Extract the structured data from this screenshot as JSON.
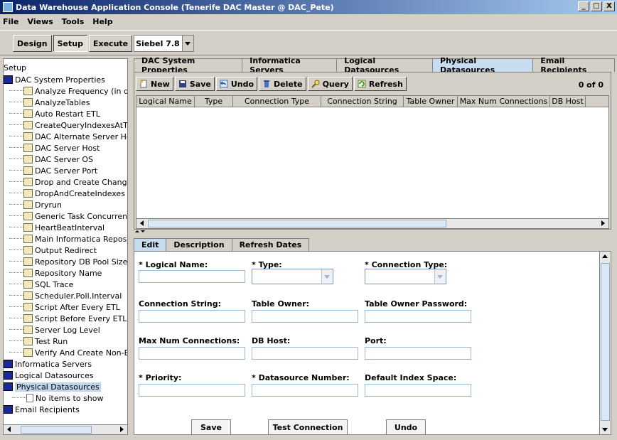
{
  "window": {
    "title": "Data Warehouse Application Console (Tenerife DAC Master @ DAC_Pete)",
    "controls": [
      "_",
      "□",
      "X"
    ]
  },
  "menu": [
    "File",
    "Views",
    "Tools",
    "Help"
  ],
  "toolbar": {
    "design": "Design",
    "setup": "Setup",
    "execute": "Execute",
    "version": "Siebel 7.8"
  },
  "tree": {
    "root": "Setup",
    "system_properties": "DAC System Properties",
    "properties": [
      "Analyze Frequency (in days)",
      "AnalyzeTables",
      "Auto Restart ETL",
      "CreateQueryIndexesAtTheEnd",
      "DAC Alternate Server Hosts",
      "DAC Server Host",
      "DAC Server OS",
      "DAC Server Port",
      "Drop and Create Change Capture Views",
      "DropAndCreateIndexes",
      "Dryrun",
      "Generic Task Concurrency",
      "HeartBeatInterval",
      "Main Informatica Repository",
      "Output Redirect",
      "Repository DB Pool Size",
      "Repository Name",
      "SQL Trace",
      "Scheduler.Poll.Interval",
      "Script After Every ETL",
      "Script Before Every ETL",
      "Server Log Level",
      "Test Run",
      "Verify And Create Non-Existing Indices"
    ],
    "informatica": "Informatica Servers",
    "logical": "Logical Datasources",
    "physical": "Physical Datasources",
    "no_items": "No items to show",
    "email": "Email Recipients"
  },
  "tabs": [
    "DAC System Properties",
    "Informatica Servers",
    "Logical Datasources",
    "Physical Datasources",
    "Email Recipients"
  ],
  "actions": {
    "new": "New",
    "save": "Save",
    "undo": "Undo",
    "delete": "Delete",
    "query": "Query",
    "refresh": "Refresh",
    "count": "0 of 0"
  },
  "columns": [
    "Logical Name",
    "Type",
    "Connection Type",
    "Connection String",
    "Table Owner",
    "Max Num Connections",
    "DB Host"
  ],
  "lower_tabs": [
    "Edit",
    "Description",
    "Refresh Dates"
  ],
  "form": {
    "logical_name": "* Logical Name:",
    "type": "* Type:",
    "connection_type": "* Connection Type:",
    "connection_string": "Connection String:",
    "table_owner": "Table Owner:",
    "table_owner_password": "Table Owner Password:",
    "max_num_connections": "Max Num Connections:",
    "db_host": "DB Host:",
    "port": "Port:",
    "priority": "* Priority:",
    "datasource_number": "* Datasource Number:",
    "default_index_space": "Default Index Space:"
  },
  "form_buttons": {
    "save": "Save",
    "test": "Test Connection",
    "undo": "Undo"
  },
  "colors": {
    "title_start": "#0a246a",
    "title_end": "#a6caf0",
    "active_tab": "#c8dcf0",
    "field_border": "#9ab8d8"
  }
}
